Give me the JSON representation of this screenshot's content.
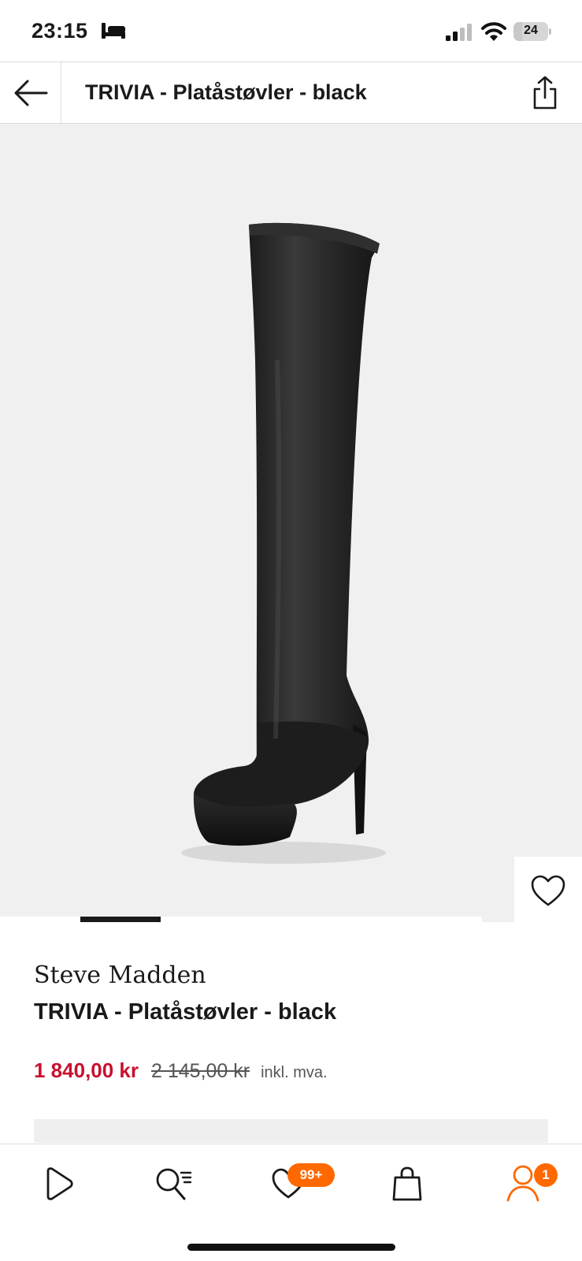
{
  "status_bar": {
    "time": "23:15",
    "battery_label": "24",
    "battery_level": 0.24,
    "icons": [
      "sleep-icon",
      "signal-icon",
      "wifi-icon",
      "battery-icon"
    ]
  },
  "header": {
    "title": "TRIVIA - Platåstøvler - black",
    "back_icon": "arrow-left-icon",
    "share_icon": "share-icon"
  },
  "gallery": {
    "image_subject": "black over-the-knee platform boot",
    "wishlist_icon": "heart-icon",
    "active_slide": 2
  },
  "product": {
    "brand": "Steve Madden",
    "name": "TRIVIA - Platåstøvler - black",
    "price_current": "1 840,00 kr",
    "price_original": "2 145,00 kr",
    "price_vat": "inkl. mva."
  },
  "bottom_nav": {
    "items": [
      {
        "icon": "play-icon",
        "badge": ""
      },
      {
        "icon": "search-icon",
        "badge": ""
      },
      {
        "icon": "heart-icon",
        "badge": "99+"
      },
      {
        "icon": "bag-icon",
        "badge": ""
      },
      {
        "icon": "profile-icon",
        "badge": "1"
      }
    ]
  },
  "colors": {
    "price_red": "#c8102e",
    "badge_orange": "#ff6900",
    "gallery_bg": "#f0f0f0"
  }
}
